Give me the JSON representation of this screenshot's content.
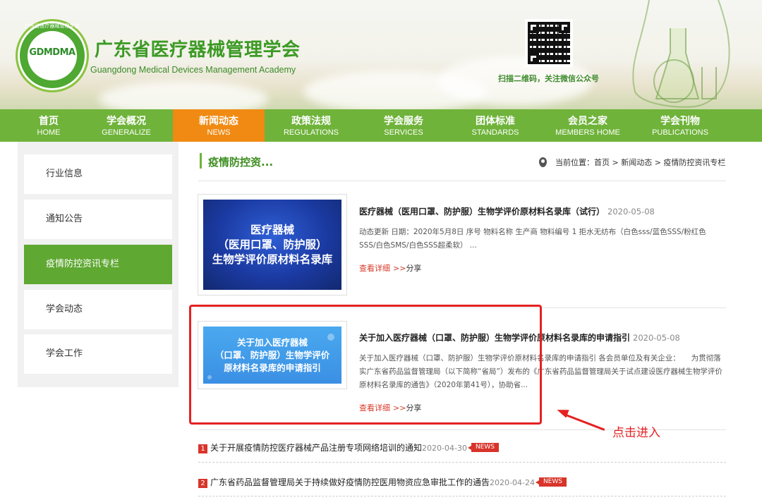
{
  "header": {
    "logo_text": "GDMDMA",
    "logo_ring_text": "广东省医疗器械管理学会",
    "title": "广东省医疗器械管理学会",
    "subtitle": "Guangdong Medical Devices Management Academy",
    "qr_caption": "扫描二维码，关注微信公众号"
  },
  "nav": [
    {
      "cn": "首页",
      "en": "HOME"
    },
    {
      "cn": "学会概况",
      "en": "GENERALIZE"
    },
    {
      "cn": "新闻动态",
      "en": "NEWS"
    },
    {
      "cn": "政策法规",
      "en": "REGULATIONS"
    },
    {
      "cn": "学会服务",
      "en": "SERVICES"
    },
    {
      "cn": "团体标准",
      "en": "STANDARDS"
    },
    {
      "cn": "会员之家",
      "en": "MEMBERS HOME"
    },
    {
      "cn": "学会刊物",
      "en": "PUBLICATIONS"
    }
  ],
  "sidebar": [
    {
      "label": "行业信息"
    },
    {
      "label": "通知公告"
    },
    {
      "label": "疫情防控资讯专栏"
    },
    {
      "label": "学会动态"
    },
    {
      "label": "学会工作"
    }
  ],
  "section_title": "疫情防控资...",
  "breadcrumb": "当前位置：首页 > 新闻动态 > 疫情防控资讯专栏",
  "articles": [
    {
      "thumb_text": "医疗器械\n（医用口罩、防护服）\n生物学评价原材料名录库",
      "title": "医疗器械（医用口罩、防护服）生物学评价原材料名录库（试行）",
      "date": "2020-05-08",
      "desc": "动态更新 日期：2020年5月8日 序号 物料名称 生产商 物料编号 1 拒水无纺布（白色sss/蓝色SSS/粉红色SSS/白色SMS/白色SSS超柔软） ...",
      "more": "查看详细",
      "arrows": ">>",
      "share": "分享"
    },
    {
      "thumb_text": "关于加入医疗器械\n（口罩、防护服）生物学评价\n原材料名录库的申请指引",
      "title": "关于加入医疗器械（口罩、防护服）生物学评价原材料名录库的申请指引",
      "date": "2020-05-08",
      "desc": "关于加入医疗器械（口罩、防护服）生物学评价原材料名录库的申请指引 各会员单位及有关企业：　　为贯彻落实广东省药品监督管理局（以下简称“省局”）发布的《广东省药品监督管理局关于试点建设医疗器械生物学评价原材料名录库的通告》（2020年第41号），协助省...",
      "more": "查看详细",
      "arrows": ">>",
      "share": "分享"
    }
  ],
  "annotation": "点击进入",
  "news": [
    {
      "num": "1",
      "title": "关于开展疫情防控医疗器械产品注册专项网络培训的通知",
      "date": "2020-04-30",
      "tag": "NEWS"
    },
    {
      "num": "2",
      "title": "广东省药品监督管理局关于持续做好疫情防控医用物资应急审批工作的通告",
      "date": "2020-04-24",
      "tag": "NEWS"
    }
  ]
}
